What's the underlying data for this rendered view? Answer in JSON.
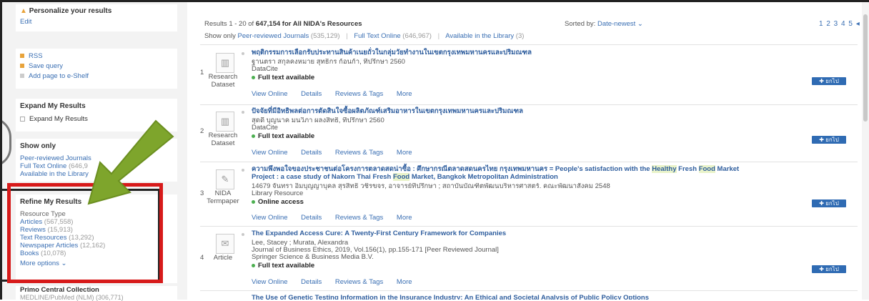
{
  "sidebar": {
    "personalize": {
      "title": "Personalize your results",
      "edit": "Edit"
    },
    "actions": [
      {
        "label": "RSS",
        "color": "#e8a33b"
      },
      {
        "label": "Save query",
        "color": "#e8a33b"
      },
      {
        "label": "Add page to e-Shelf",
        "color": "#cccccc"
      }
    ],
    "expand": {
      "title": "Expand My Results",
      "checkbox": "Expand My Results"
    },
    "showonly": {
      "title": "Show only",
      "items": [
        {
          "label": "Peer-reviewed Journals",
          "count": ""
        },
        {
          "label": "Full Text Online",
          "count": "(646,9"
        },
        {
          "label": "Available in the Library",
          "count": ""
        }
      ]
    },
    "refine": {
      "title": "Refine My Results",
      "subtitle": "Resource Type",
      "items": [
        {
          "label": "Articles",
          "count": "(567,558)"
        },
        {
          "label": "Reviews",
          "count": "(15,913)"
        },
        {
          "label": "Text Resources",
          "count": "(13,292)"
        },
        {
          "label": "Newspaper Articles",
          "count": "(12,162)"
        },
        {
          "label": "Books",
          "count": "(10,078)"
        }
      ],
      "more": "More options ⌄"
    },
    "collection": {
      "title": "Primo Central Collection",
      "sub": "MEDLINE/PubMed (NLM)",
      "count": "(306,771)"
    }
  },
  "header": {
    "results_prefix": "Results 1 - 20 of",
    "results_count": "647,154",
    "results_suffix": "for All NIDA's Resources",
    "showonly_label": "Show only",
    "filters": [
      {
        "label": "Peer-reviewed Journals",
        "count": "(535,129)"
      },
      {
        "label": "Full Text Online",
        "count": "(646,967)"
      },
      {
        "label": "Available in the Library",
        "count": "(3)"
      }
    ],
    "sorted_label": "Sorted by:",
    "sorted_value": "Date-newest ⌄",
    "pages": "1 2 3 4 5 ◂"
  },
  "results": [
    {
      "num": "1",
      "icon": "bar-chart-icon",
      "type": "Research Dataset",
      "title": "พฤติกรรมการเลือกรับประทานสินค้าเนยถั่วในกลุ่มวัยทำงานในเขตกรุงเทพมหานครและปริมณฑล",
      "authors": "ฐานตรา สกุลคงหมาย สุทธิกร ก้อนก้า, ที่ปรึกษา 2560",
      "source": "DataCite",
      "availability": "Full text available",
      "tabs": [
        "View Online",
        "Details",
        "Reviews & Tags",
        "More"
      ],
      "pin": "✚ ยกไป"
    },
    {
      "num": "2",
      "icon": "bar-chart-icon",
      "type": "Research Dataset",
      "title": "ปัจจัยที่มีอิทธิพลต่อการตัดสินใจซื้อผลิตภัณฑ์เสริมอาหารในเขตกรุงเทพมหานครและปริมณฑล",
      "authors": "สุดดี บุญนาค มนวิภา ผลงสิทธิ์, ที่ปรึกษา 2560",
      "source": "DataCite",
      "availability": "Full text available",
      "tabs": [
        "View Online",
        "Details",
        "Reviews & Tags",
        "More"
      ],
      "pin": "✚ ยกไป"
    },
    {
      "num": "3",
      "icon": "pen-icon",
      "type": "NIDA Termpaper",
      "title_a": "ความพึงพอใจของประชาชนต่อโครงการตลาดสดน่าซื้อ : ศึกษากรณีตลาดสดนครไทย กรุงเทพมหานคร = People's satisfaction with the ",
      "title_hl1": "Healthy",
      "title_b": " Fresh ",
      "title_hl2": "Food",
      "title_c": " Market Project : a case study of Nakorn Thai Fresh ",
      "title_hl3": "Food",
      "title_d": " Market, Bangkok Metropolitan Administration",
      "authors": "14679 จันทรา อิ่มบุญญาบุคล สุรสิทธิ์ วชิรขจร, อาจารย์ที่ปรึกษา ; สถาบันบัณฑิตพัฒนบริหารศาสตร์. คณะพัฒนาสังคม 2548",
      "source": "Library Resource",
      "availability": "Online access",
      "tabs": [
        "View Online",
        "Details",
        "Reviews & Tags",
        "More"
      ],
      "pin": "✚ ยกไป"
    },
    {
      "num": "4",
      "icon": "article-icon",
      "type": "Article",
      "title": "The Expanded Access Cure: A Twenty-First Century Framework for Companies",
      "authors": "Lee, Stacey ; Murata, Alexandra",
      "source": "Journal of Business Ethics, 2019, Vol.156(1), pp.155-171 [Peer Reviewed Journal]",
      "publisher": "Springer Science & Business Media B.V.",
      "availability": "Full text available",
      "tabs": [
        "View Online",
        "Details",
        "Reviews & Tags",
        "More"
      ],
      "pin": "✚ ยกไป"
    },
    {
      "title": "The Use of Genetic Testing Information in the Insurance Industry: An Ethical and Societal Analysis of Public Policy Options"
    }
  ],
  "colors": {
    "accent": "#3a6fb3",
    "red": "#d71a1a",
    "arrow": "#7ea52c"
  }
}
